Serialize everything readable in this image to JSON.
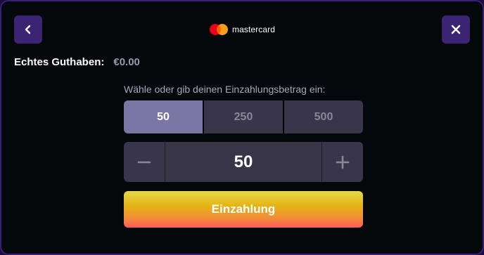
{
  "header": {
    "back_icon": "chevron-left-icon",
    "close_icon": "close-icon",
    "brand_icon": "mastercard-logo",
    "brand_text": "mastercard"
  },
  "balance": {
    "label": "Echtes Guthaben:",
    "value": "€0.00"
  },
  "deposit": {
    "prompt": "Wähle oder gib deinen Einzahlungsbetrag ein:",
    "presets": [
      "50",
      "250",
      "500"
    ],
    "selected_preset": "50",
    "amount": "50",
    "submit_label": "Einzahlung"
  },
  "colors": {
    "background": "#04080a",
    "border": "#3a1c7a",
    "icon_button": "#3b2473",
    "preset": "#39354a",
    "preset_active": "#7a77a4",
    "submit_gradient_top": "#e7d84a",
    "submit_gradient_bottom": "#ff5b5b"
  }
}
